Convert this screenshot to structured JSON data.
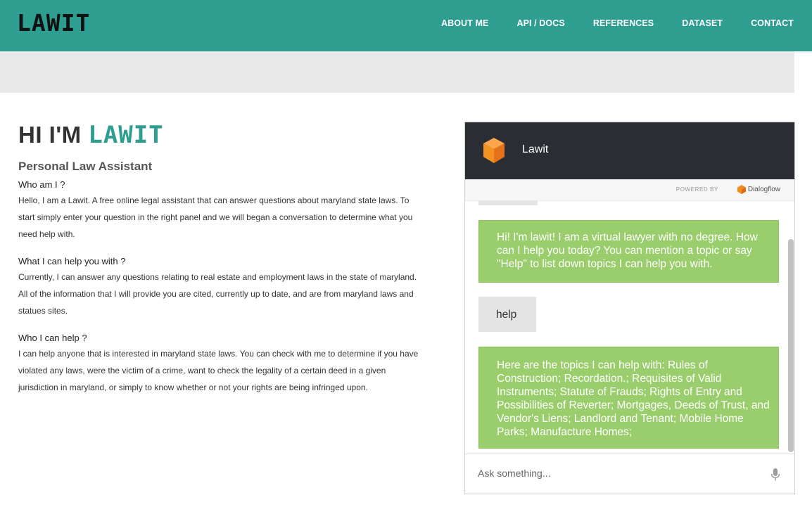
{
  "header": {
    "logo": "LAWIT",
    "nav": [
      {
        "label": "ABOUT ME"
      },
      {
        "label": "API / DOCS"
      },
      {
        "label": "REFERENCES"
      },
      {
        "label": "DATASET"
      },
      {
        "label": "CONTACT"
      }
    ]
  },
  "colors": {
    "accent": "#2e9e91",
    "bot_bubble": "#9acd6c",
    "chat_header": "#2a2d33"
  },
  "intro": {
    "hero_prefix": "HI I'M ",
    "hero_brand": "LAWIT",
    "subtitle": "Personal Law Assistant",
    "sections": [
      {
        "question": "Who am I ?",
        "answer": "Hello, I am a Lawit. A free online legal assistant that can answer questions about maryland state laws. To start simply enter your question in the right panel and we will began a conversation to determine what you need help with."
      },
      {
        "question": "What I can help you with ?",
        "answer": "Currently, I can answer any questions relating to real estate and employment laws in the state of maryland. All of the information that I will provide you are cited, currently up to date, and are from maryland laws and statues sites."
      },
      {
        "question": "Who I can help ?",
        "answer": "I can help anyone that is interested in maryland state laws. You can check with me to determine if you have violated any laws, were the victim of a crime, want to check the legality of a certain deed in a given jurisdiction in maryland, or simply to know whether or not your rights are being infringed upon."
      }
    ]
  },
  "chat": {
    "title": "Lawit",
    "powered_by": "POWERED BY",
    "provider": "Dialogflow",
    "messages": [
      {
        "from": "bot",
        "text": "Hi! I'm lawit! I am a virtual lawyer with no degree. How can I help you today? You can mention a topic or say \"Help\" to list down topics I can help you with."
      },
      {
        "from": "user",
        "text": "help"
      },
      {
        "from": "bot",
        "text": "Here are the topics I can help with: Rules of Construction; Recordation.; Requisites of Valid Instruments; Statute of Frauds; Rights of Entry and Possibilities of Reverter; Mortgages, Deeds of Trust, and Vendor's Liens; Landlord and Tenant; Mobile Home Parks; Manufacture Homes;"
      }
    ],
    "input_placeholder": "Ask something...",
    "icons": {
      "bot_avatar": "cube-icon",
      "mic": "mic-icon"
    }
  }
}
